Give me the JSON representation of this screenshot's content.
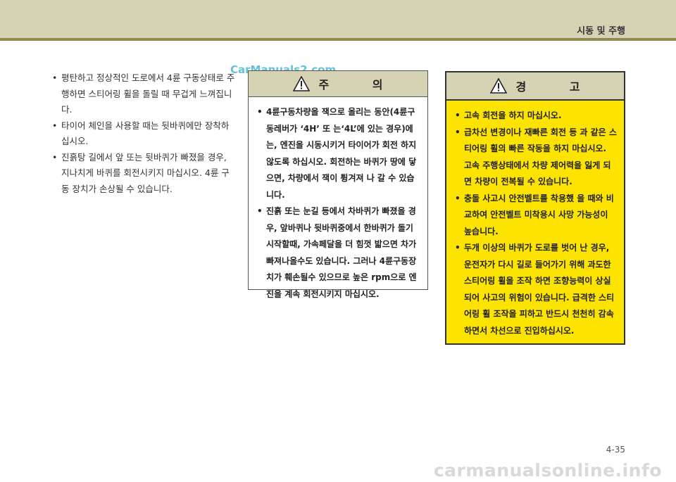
{
  "header": {
    "section_title": "시동 및 주행"
  },
  "watermark_top": "CarManuals2.com",
  "left_bullets": [
    "평탄하고 정상적인 도로에서 4륜 구동상태로 주행하면 스티어링 휠을 돌릴 때 무겁게 느껴집니다.",
    "타이어 체인을 사용할 때는 뒷바퀴에만 장착하십시오.",
    "진흙탕 길에서 앞 또는 뒷바퀴가 빠졌을 경우, 지나치게 바퀴를 회전시키지 마십시오. 4륜 구동 장치가 손상될 수 있습니다."
  ],
  "caution": {
    "title": "주 의",
    "items": [
      "4륜구동차량을 잭으로 올리는 동안(4륜구동레버가 ‘4H’ 또 는‘4L’에 있는 경우)에는, 엔진을 시동시키거 타이어가 회전 하지 않도록 하십시오. 회전하는 바퀴가 땅에 닿으면, 차량에서 잭이 튕겨져 나 갈 수 있습니다.",
      "진흙 또는 눈길 등에서 차바퀴가 빠졌을 경우, 앞바퀴나 뒷바퀴중에서 한바퀴가 돌기 시작할때, 가속페달을 더 힘껏 밟으면 차가 빠져나올수도 있습니다. 그러나 4륜구동장치가 훼손될수 있으므로 높은 rpm으로 엔진을 계속 회전시키지 마십시오."
    ]
  },
  "warning": {
    "title": "경 고",
    "items": [
      "고속 회전을 하지 마십시오.",
      "급차선 변경이나 재빠른 회전 등 과 같은 스티어링 휠의 빠른 작동을 하지 마십시오. 고속 주행상태에서 차량 제어력을 잃게 되면 차량이 전복될 수 있습니다.",
      "충돌 사고시 안전벨트를 착용했 을 때와 비교하여 안전벨트 미착용시 사망 가능성이 높습니다.",
      "두개 이상의 바퀴가 도로를 벗어 난 경우, 운전자가 다시 길로 들어가기 위해 과도한 스티어링 휠을 조작 하면 조향능력이 상실되어 사고의 위험이 있습니다. 급격한 스티어링 휠 조작을 피하고 반드시 천천히 감속하면서 차선으로 진입하십시오."
    ]
  },
  "page_number": "4-35",
  "watermark_bottom": "carmanualsonline.info",
  "colors": {
    "header_band": "#d6d3b4",
    "header_rule": "#8d8b52",
    "warning_fill": "#fce300"
  }
}
